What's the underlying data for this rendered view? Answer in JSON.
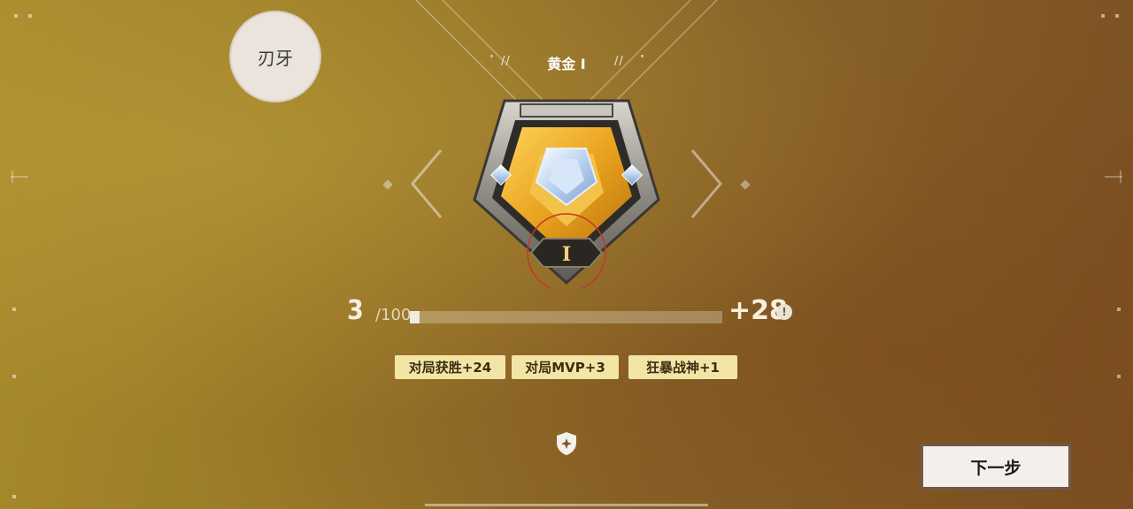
{
  "player": {
    "name": "刃牙"
  },
  "rank": {
    "title": "黄金 I",
    "tier_numeral": "I",
    "slashes": "//"
  },
  "progress": {
    "current": "3",
    "max": "/100",
    "gain": "+28",
    "fraction": 0.03,
    "info_symbol": "!"
  },
  "bonuses": [
    {
      "label": "对局获胜+24"
    },
    {
      "label": "对局MVP+3"
    },
    {
      "label": "狂暴战神+1"
    }
  ],
  "actions": {
    "next_label": "下一步"
  },
  "icons": {
    "shield": "shield-icon",
    "info": "info-icon"
  },
  "colors": {
    "chip_bg": "#f3e5a6",
    "gold": "#e8a21c",
    "progress_fill": "#f0ebe3"
  }
}
